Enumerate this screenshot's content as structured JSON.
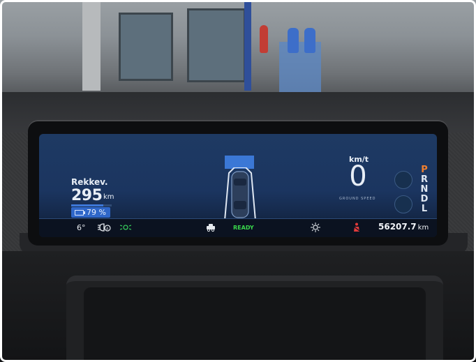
{
  "cluster": {
    "range": {
      "label": "Rekkev.",
      "value": "295",
      "unit": "km",
      "battery_percent_text": "79 %",
      "battery_level": 0.79
    },
    "speed": {
      "unit": "km/t",
      "value": "0",
      "mode_label": "GROUND SPEED"
    },
    "gear_selector": {
      "gears": [
        "P",
        "R",
        "N",
        "D",
        "L"
      ],
      "selected": "P"
    },
    "status_bar": {
      "temperature": "6°",
      "ready": "READY",
      "odometer_value": "56207.7",
      "odometer_unit": "km"
    },
    "icons": [
      "auto-headlight-icon",
      "parking-lights-icon",
      "vehicle-status-icon",
      "traction-control-icon",
      "seatbelt-warning-icon",
      "vehicle-silhouette-icon"
    ],
    "colors": {
      "accent_blue": "#3b78d6",
      "gear_active": "#f07f2f",
      "ready_green": "#39d54b",
      "warning_red": "#e23b3b",
      "indicator_green": "#35c85a"
    }
  }
}
